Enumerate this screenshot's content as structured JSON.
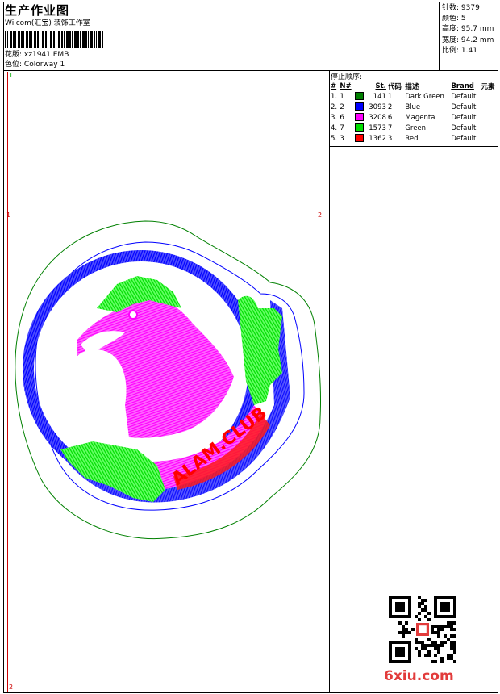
{
  "header": {
    "title": "生产作业图",
    "studio": "Wilcom(汇宝)  装饰工作室",
    "design_label": "花版:",
    "design_value": "xz1941.EMB",
    "colorway_label": "色位:",
    "colorway_value": "Colorway 1"
  },
  "stats": [
    {
      "label": "针数:",
      "value": "9379"
    },
    {
      "label": "颜色:",
      "value": "5"
    },
    {
      "label": "高度:",
      "value": "95.7 mm"
    },
    {
      "label": "宽度:",
      "value": "94.2 mm"
    },
    {
      "label": "比例:",
      "value": "1.41"
    }
  ],
  "stop_table": {
    "title": "停止顺序:",
    "headers": {
      "idx": "#",
      "n": "N#",
      "st": "St.",
      "code": "代码",
      "desc": "描述",
      "brand": "Brand",
      "elem": "元素"
    },
    "rows": [
      {
        "idx": "1.",
        "n": "1",
        "color": "#008000",
        "st": "141",
        "code": "1",
        "desc": "Dark Green",
        "brand": "Default"
      },
      {
        "idx": "2.",
        "n": "2",
        "color": "#0000ff",
        "st": "3093",
        "code": "2",
        "desc": "Blue",
        "brand": "Default"
      },
      {
        "idx": "3.",
        "n": "6",
        "color": "#ff00ff",
        "st": "3208",
        "code": "6",
        "desc": "Magenta",
        "brand": "Default"
      },
      {
        "idx": "4.",
        "n": "7",
        "color": "#00e000",
        "st": "1573",
        "code": "7",
        "desc": "Green",
        "brand": "Default"
      },
      {
        "idx": "5.",
        "n": "3",
        "color": "#ff0000",
        "st": "1362",
        "code": "3",
        "desc": "Red",
        "brand": "Default"
      }
    ]
  },
  "canvas": {
    "marks": {
      "top_left_green": "1",
      "mid_left": "1",
      "mid_right": "2",
      "bottom_left": "2"
    },
    "ribbon_text": "ALAM.CLUB"
  },
  "watermark": {
    "main": "6xiu",
    "tld": ".com"
  },
  "colors": {
    "guide": "#cc0000",
    "dark_green": "#008000",
    "blue": "#0000ff",
    "magenta": "#ff00ff",
    "green": "#00e000",
    "red": "#ff0000"
  }
}
